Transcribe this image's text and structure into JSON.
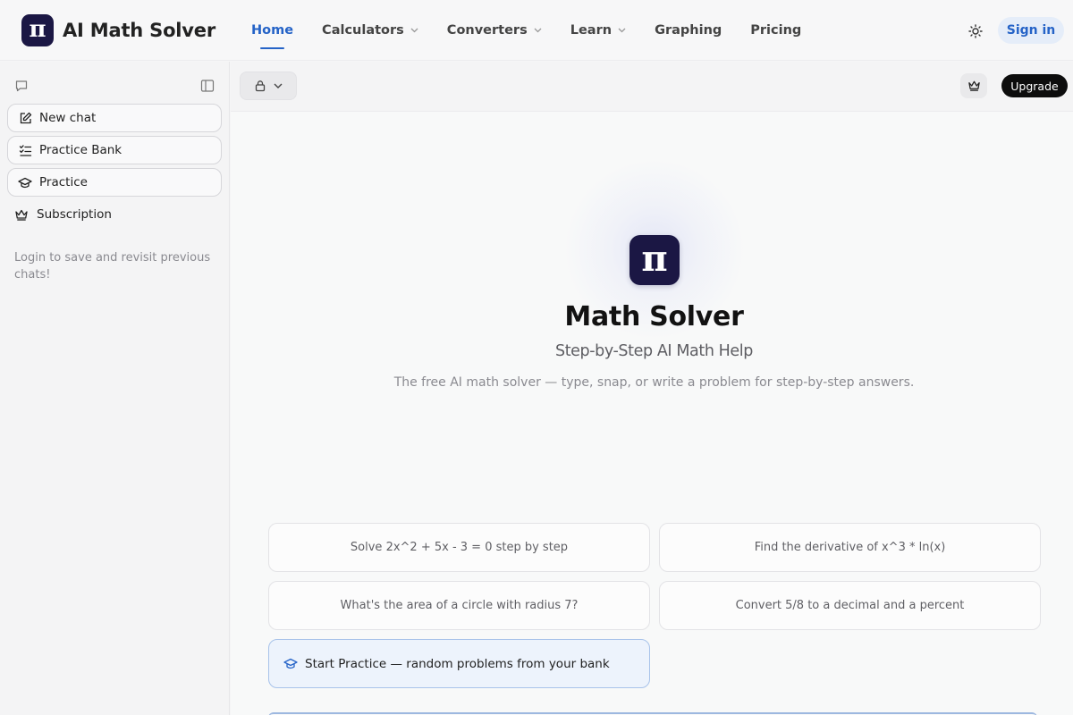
{
  "brand": {
    "name": "AI Math Solver",
    "logo_glyph": "π"
  },
  "nav": {
    "items": [
      {
        "label": "Home",
        "active": true,
        "dropdown": false
      },
      {
        "label": "Calculators",
        "active": false,
        "dropdown": true
      },
      {
        "label": "Converters",
        "active": false,
        "dropdown": true
      },
      {
        "label": "Learn",
        "active": false,
        "dropdown": true
      },
      {
        "label": "Graphing",
        "active": false,
        "dropdown": false
      },
      {
        "label": "Pricing",
        "active": false,
        "dropdown": false
      }
    ],
    "theme_icon": "sun-icon",
    "sign_in_label": "Sign in"
  },
  "sidebar": {
    "items": [
      {
        "label": "New chat",
        "icon": "edit-icon"
      },
      {
        "label": "Practice Bank",
        "icon": "checklist-icon"
      },
      {
        "label": "Practice",
        "icon": "graduation-cap-icon"
      },
      {
        "label": "Subscription",
        "icon": "crown-icon"
      }
    ],
    "note": "Login to save and revisit previous chats!"
  },
  "toolbar": {
    "upgrade_label": "Upgrade"
  },
  "hero": {
    "logo_glyph": "π",
    "title": "Math Solver",
    "subtitle": "Step-by-Step AI Math Help",
    "description": "The free AI math solver — type, snap, or write a problem for step-by-step answers."
  },
  "suggestions": [
    "Solve 2x^2 + 5x - 3 = 0 step by step",
    "Find the derivative of x^3 * ln(x)",
    "What's the area of a circle with radius 7?",
    "Convert 5/8 to a decimal and a percent"
  ],
  "practice_card": {
    "label": "Start Practice — random problems from your bank"
  },
  "colors": {
    "brand_dark": "#1b1744",
    "accent": "#2563c7",
    "upgrade_bg": "#0d0d0d"
  }
}
